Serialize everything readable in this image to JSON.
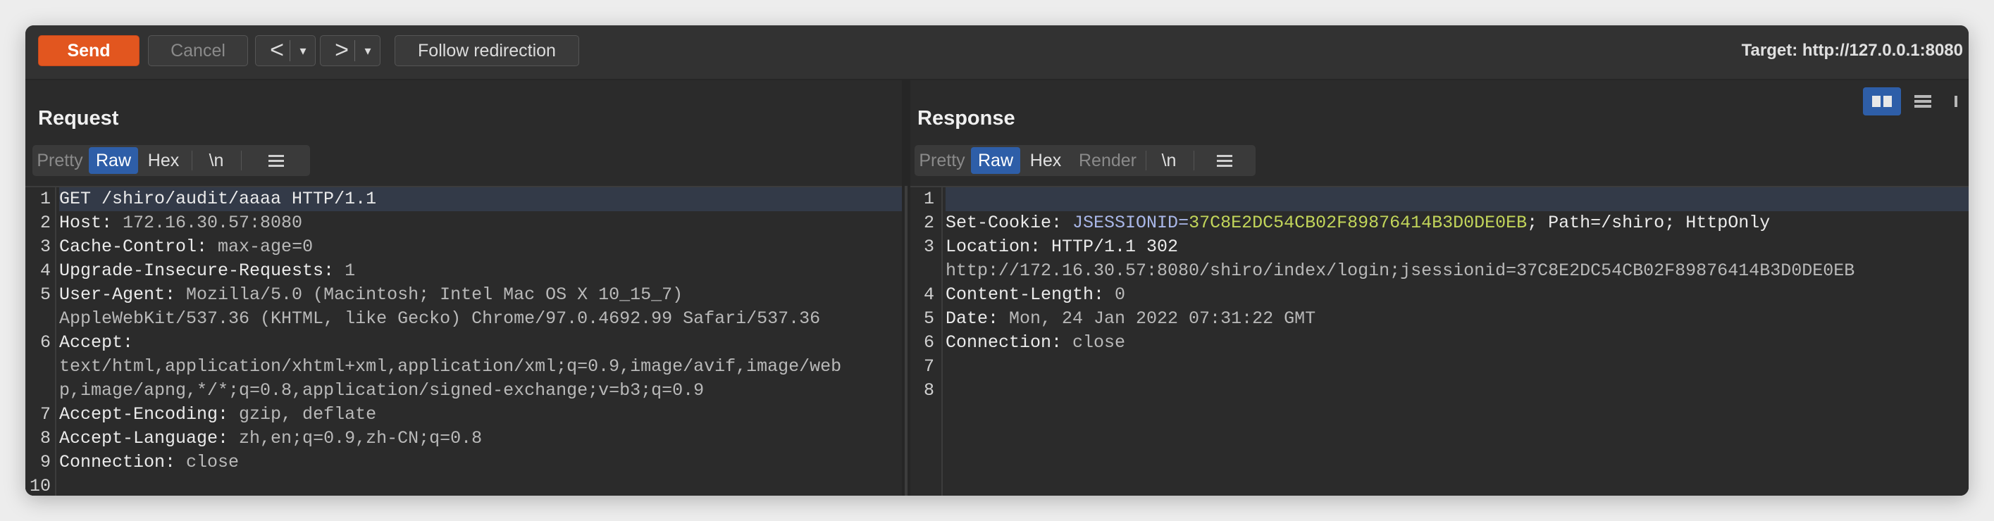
{
  "toolbar": {
    "send_label": "Send",
    "cancel_label": "Cancel",
    "back_arrow": "<",
    "forward_arrow": ">",
    "dropdown_glyph": "▾",
    "follow_label": "Follow redirection",
    "target_label": "Target: http://127.0.0.1:8080"
  },
  "view_toggles": [
    "split-horizontal",
    "split-vertical",
    "single"
  ],
  "request": {
    "title": "Request",
    "tabs": [
      "Pretty",
      "Raw",
      "Hex",
      "\\n"
    ],
    "active_tab": "Raw",
    "line_numbers": [
      "1",
      "2",
      "3",
      "4",
      "5",
      "",
      "6",
      "",
      "",
      "7",
      "8",
      "9",
      "10"
    ],
    "lines": [
      {
        "key": "GET /shiro/audit/aaaa HTTP/1.1",
        "value": ""
      },
      {
        "key": "Host: ",
        "value": "172.16.30.57:8080"
      },
      {
        "key": "Cache-Control: ",
        "value": "max-age=0"
      },
      {
        "key": "Upgrade-Insecure-Requests: ",
        "value": "1"
      },
      {
        "key": "User-Agent: ",
        "value": "Mozilla/5.0 (Macintosh; Intel Mac OS X 10_15_7)"
      },
      {
        "key": "",
        "value": "AppleWebKit/537.36 (KHTML, like Gecko) Chrome/97.0.4692.99 Safari/537.36"
      },
      {
        "key": "Accept:",
        "value": ""
      },
      {
        "key": "",
        "value": "text/html,application/xhtml+xml,application/xml;q=0.9,image/avif,image/web"
      },
      {
        "key": "",
        "value": "p,image/apng,*/*;q=0.8,application/signed-exchange;v=b3;q=0.9"
      },
      {
        "key": "Accept-Encoding: ",
        "value": "gzip, deflate"
      },
      {
        "key": "Accept-Language: ",
        "value": "zh,en;q=0.9,zh-CN;q=0.8"
      },
      {
        "key": "Connection: ",
        "value": "close"
      },
      {
        "key": "",
        "value": ""
      }
    ]
  },
  "response": {
    "title": "Response",
    "tabs": [
      "Pretty",
      "Raw",
      "Hex",
      "Render",
      "\\n"
    ],
    "active_tab": "Raw",
    "line_numbers": [
      "1",
      "2",
      "3",
      "",
      "4",
      "5",
      "6",
      "7",
      "8"
    ],
    "status_line": "HTTP/1.1 302",
    "set_cookie": {
      "key": "Set-Cookie: ",
      "cookie_name": "JSESSIONID",
      "eq": "=",
      "cookie_value": "37C8E2DC54CB02F89876414B3D0DE0EB",
      "rest": "; Path=/shiro; HttpOnly"
    },
    "location_key": "Location:",
    "location_value": "http://172.16.30.57:8080/shiro/index/login;jsessionid=37C8E2DC54CB02F89876414B3D0DE0EB",
    "content_length": {
      "key": "Content-Length: ",
      "value": "0"
    },
    "date": {
      "key": "Date: ",
      "value": "Mon, 24 Jan 2022 07:31:22 GMT"
    },
    "connection": {
      "key": "Connection: ",
      "value": "close"
    }
  }
}
